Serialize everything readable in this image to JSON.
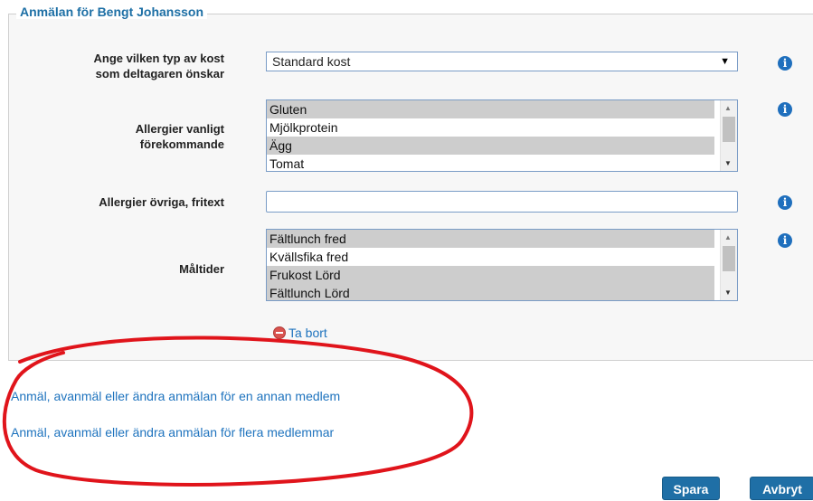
{
  "form": {
    "legend": "Anmälan för Bengt Johansson",
    "diet": {
      "label_line1": "Ange vilken typ av kost",
      "label_line2": "som deltagaren önskar",
      "selected": "Standard kost"
    },
    "allergies_common": {
      "label_line1": "Allergier vanligt",
      "label_line2": "förekommande",
      "options": [
        {
          "text": "Gluten",
          "selected": true
        },
        {
          "text": "Mjölkprotein",
          "selected": false
        },
        {
          "text": "Ägg",
          "selected": true
        },
        {
          "text": "Tomat",
          "selected": false
        }
      ]
    },
    "allergies_other": {
      "label": "Allergier övriga, fritext",
      "value": ""
    },
    "meals": {
      "label": "Måltider",
      "options": [
        {
          "text": "Fältlunch fred",
          "selected": true
        },
        {
          "text": "Kvällsfika fred",
          "selected": false
        },
        {
          "text": "Frukost Lörd",
          "selected": true
        },
        {
          "text": "Fältlunch Lörd",
          "selected": true
        }
      ]
    },
    "remove_label": "Ta bort"
  },
  "links": {
    "other_member": "Anmäl, avanmäl eller ändra anmälan för en annan medlem",
    "multiple_members": "Anmäl, avanmäl eller ändra anmälan för flera medlemmar"
  },
  "buttons": {
    "save": "Spara",
    "cancel": "Avbryt"
  },
  "colors": {
    "accent": "#1e73be",
    "annotation": "#e0141b"
  }
}
